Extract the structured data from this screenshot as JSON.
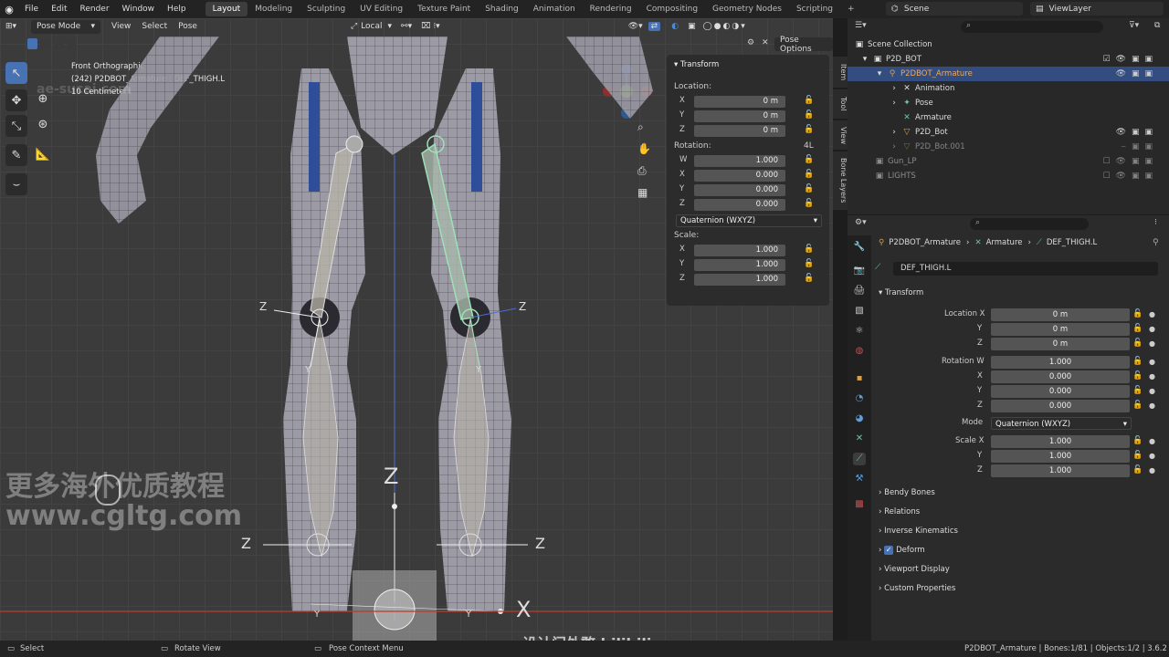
{
  "topbar": {
    "menus": [
      "File",
      "Edit",
      "Render",
      "Window",
      "Help"
    ],
    "workspaces": [
      "Layout",
      "Modeling",
      "Sculpting",
      "UV Editing",
      "Texture Paint",
      "Shading",
      "Animation",
      "Rendering",
      "Compositing",
      "Geometry Nodes",
      "Scripting"
    ],
    "active_workspace": "Layout",
    "add_tab": "+",
    "scene": "Scene",
    "view_layer": "ViewLayer"
  },
  "viewport_header": {
    "mode": "Pose Mode",
    "menus": [
      "View",
      "Select",
      "Pose"
    ],
    "transform_orientation": "Local",
    "pose_options": "Pose Options"
  },
  "viewport_info": {
    "view_name": "Front Orthographic",
    "object_line": "(242) P2DBOT_Armature : DEF_THIGH.L",
    "scale": "10 Centimeters"
  },
  "axis_labels": {
    "z": "Z",
    "y": "Y",
    "x": "X"
  },
  "npanel": {
    "section": "Transform",
    "location_label": "Location:",
    "location": [
      {
        "axis": "X",
        "value": "0 m"
      },
      {
        "axis": "Y",
        "value": "0 m"
      },
      {
        "axis": "Z",
        "value": "0 m"
      }
    ],
    "rotation_label": "Rotation:",
    "rotation_mode_tag": "4L",
    "rotation": [
      {
        "axis": "W",
        "value": "1.000"
      },
      {
        "axis": "X",
        "value": "0.000"
      },
      {
        "axis": "Y",
        "value": "0.000"
      },
      {
        "axis": "Z",
        "value": "0.000"
      }
    ],
    "rotation_mode": "Quaternion (WXYZ)",
    "scale_label": "Scale:",
    "scale": [
      {
        "axis": "X",
        "value": "1.000"
      },
      {
        "axis": "Y",
        "value": "1.000"
      },
      {
        "axis": "Z",
        "value": "1.000"
      }
    ],
    "tabs": [
      "Item",
      "Tool",
      "View",
      "Bone Layers"
    ]
  },
  "outliner": {
    "items": [
      {
        "label": "Scene Collection"
      },
      {
        "label": "P2D_BOT"
      },
      {
        "label": "P2DBOT_Armature"
      },
      {
        "label": "Animation"
      },
      {
        "label": "Pose"
      },
      {
        "label": "Armature"
      },
      {
        "label": "P2D_Bot"
      },
      {
        "label": "P2D_Bot.001"
      },
      {
        "label": "Gun_LP"
      },
      {
        "label": "LIGHTS"
      }
    ]
  },
  "properties": {
    "breadcrumb": [
      "P2DBOT_Armature",
      "Armature",
      "DEF_THIGH.L"
    ],
    "bone_name": "DEF_THIGH.L",
    "transform_section": "Transform",
    "fields": [
      {
        "label": "Location X",
        "value": "0 m"
      },
      {
        "label": "Y",
        "value": "0 m"
      },
      {
        "label": "Z",
        "value": "0 m"
      },
      {
        "label": "Rotation W",
        "value": "1.000"
      },
      {
        "label": "X",
        "value": "0.000"
      },
      {
        "label": "Y",
        "value": "0.000"
      },
      {
        "label": "Z",
        "value": "0.000"
      },
      {
        "label": "Mode",
        "value": "Quaternion (WXYZ)"
      },
      {
        "label": "Scale X",
        "value": "1.000"
      },
      {
        "label": "Y",
        "value": "1.000"
      },
      {
        "label": "Z",
        "value": "1.000"
      }
    ],
    "sections": [
      "Bendy Bones",
      "Relations",
      "Inverse Kinematics",
      "Deform",
      "Viewport Display",
      "Custom Properties"
    ]
  },
  "statusbar": {
    "select": "Select",
    "rotate": "Rotate View",
    "context": "Pose Context Menu",
    "stats": "P2DBOT_Armature | Bones:1/81 | Objects:1/2 | 3.6.2"
  },
  "watermarks": {
    "cn_line": "更多海外优质教程",
    "url": "www.cgltg.com",
    "bottom": "设计门外憨 bilibili",
    "top_url": "ae-sucai.com"
  },
  "colors": {
    "accent": "#4772b3",
    "selected_row": "#334d80",
    "bone_active": "#9fe0b8",
    "x_axis": "#c0392b"
  }
}
